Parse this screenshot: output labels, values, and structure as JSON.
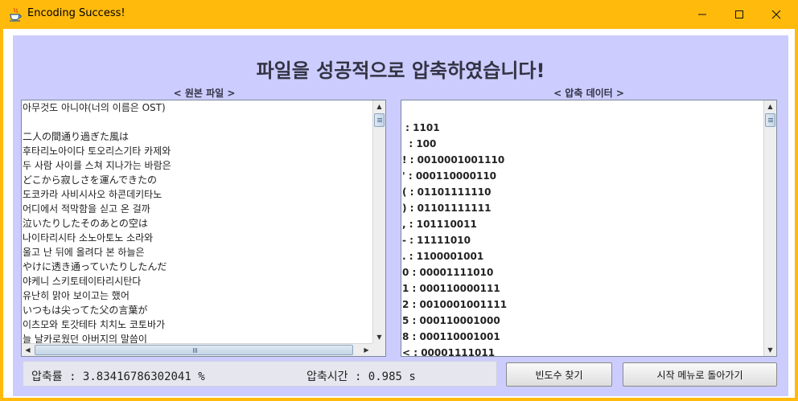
{
  "window": {
    "title": "Encoding Success!",
    "colors": {
      "titlebar": "#ffba0c",
      "panel": "#ccccff"
    },
    "icon": "java-cup-icon",
    "controls": [
      "minimize-icon",
      "maximize-icon",
      "close-icon"
    ]
  },
  "heading": "파일을 성공적으로 압축하였습니다!",
  "original_pane": {
    "label": "< 원본 파일 >",
    "lines": [
      "아무것도 아니야(너의 이름은 OST)",
      "",
      "二人の間通り過ぎた風は",
      "후타리노아이다 토오리스기타 카제와",
      "두 사람 사이를 스쳐 지나가는 바람은",
      "どこから寂しさを運んできたの",
      "도코카라 사비시사오 하콘데키타노",
      "어디에서 적막함을 싣고 온 걸까",
      "泣いたりしたそのあとの空は",
      "나이타리시타 소노아토노 소라와",
      "울고 난 뒤에 올려다 본 하늘은",
      "やけに透き通っていたりしたんだ",
      "야케니 스키토테이타리시탄다",
      "유난히 맑아 보이고는 했어",
      "いつもは尖ってた父の言葉が",
      "이츠모와 토갓테타 치치노 코토바가",
      "늘 날카로웠던 아버지의 말씀이"
    ]
  },
  "compressed_pane": {
    "label": "< 압축 데이터 >",
    "lines": [
      "",
      " : 1101",
      "  : 100",
      "! : 0010001001110",
      "' : 000110000110",
      "( : 01101111110",
      ") : 01101111111",
      ", : 101110011",
      "- : 11111010",
      ". : 1100001001",
      "0 : 00001111010",
      "1 : 000110000111",
      "2 : 0010001001111",
      "5 : 000110001000",
      "8 : 000110001001",
      "< : 00001111011"
    ]
  },
  "status": {
    "ratio_text": "압축률 : 3.83416786302041 %",
    "time_text": "압축시간 : 0.985 s"
  },
  "buttons": {
    "frequency": "빈도수 찾기",
    "back_to_menu": "시작 메뉴로 돌아가기"
  }
}
